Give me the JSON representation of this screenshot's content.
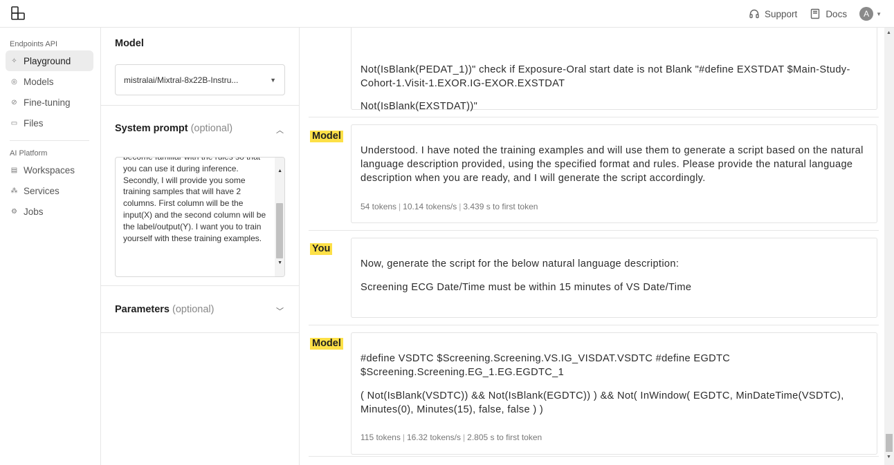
{
  "header": {
    "logo_icon": "layers-logo-icon",
    "support_label": "Support",
    "docs_label": "Docs",
    "avatar_initial": "A"
  },
  "sidebar": {
    "section1": "Endpoints API",
    "items1": [
      {
        "label": "Playground",
        "icon": "sparkle-icon",
        "active": true
      },
      {
        "label": "Models",
        "icon": "globe-icon"
      },
      {
        "label": "Fine-tuning",
        "icon": "circle-check-icon"
      },
      {
        "label": "Files",
        "icon": "folder-icon"
      }
    ],
    "section2": "AI Platform",
    "items2": [
      {
        "label": "Workspaces",
        "icon": "window-icon"
      },
      {
        "label": "Services",
        "icon": "broadcast-icon"
      },
      {
        "label": "Jobs",
        "icon": "gear-icon"
      }
    ]
  },
  "config": {
    "model_title": "Model",
    "model_value": "mistralai/Mixtral-8x22B-Instru...",
    "system_title": "System prompt",
    "system_optional": "(optional)",
    "system_text": "become familiar with the rules so that you can use it during inference. Secondly, I will provide you some training samples that will have 2 columns. First column will be the input(X) and the second column will be the label/output(Y). I want you to train yourself with these training examples.",
    "params_title": "Parameters",
    "params_optional": "(optional)"
  },
  "chat": {
    "messages": [
      {
        "role": "",
        "paragraphs": [
          "Not(IsBlank(PEDAT_1))\" check if Exposure-Oral start date is not Blank \"#define EXSTDAT $Main-Study-Cohort-1.Visit-1.EXOR.IG-EXOR.EXSTDAT",
          "Not(IsBlank(EXSTDAT))\""
        ]
      },
      {
        "role": "Model",
        "paragraphs": [
          "Understood. I have noted the training examples and will use them to generate a script based on the natural language description provided, using the specified format and rules. Please provide the natural language description when you are ready, and I will generate the script accordingly."
        ],
        "meta": {
          "tokens": "54 tokens",
          "speed": "10.14 tokens/s",
          "latency": "3.439 s to first token"
        }
      },
      {
        "role": "You",
        "paragraphs": [
          "Now, generate the script for the below natural language description:",
          "Screening ECG Date/Time must be within 15 minutes of VS Date/Time"
        ]
      },
      {
        "role": "Model",
        "paragraphs": [
          "#define VSDTC $Screening.Screening.VS.IG_VISDAT.VSDTC #define EGDTC $Screening.Screening.EG_1.EG.EGDTC_1",
          "( Not(IsBlank(VSDTC)) && Not(IsBlank(EGDTC)) ) && Not( InWindow( EGDTC, MinDateTime(VSDTC), Minutes(0), Minutes(15), false, false ) )"
        ],
        "meta": {
          "tokens": "115 tokens",
          "speed": "16.32 tokens/s",
          "latency": "2.805 s to first token"
        }
      }
    ]
  },
  "colors": {
    "role_highlight": "#fde047",
    "active_nav_bg": "#ececec",
    "border": "#e6e6e6"
  }
}
